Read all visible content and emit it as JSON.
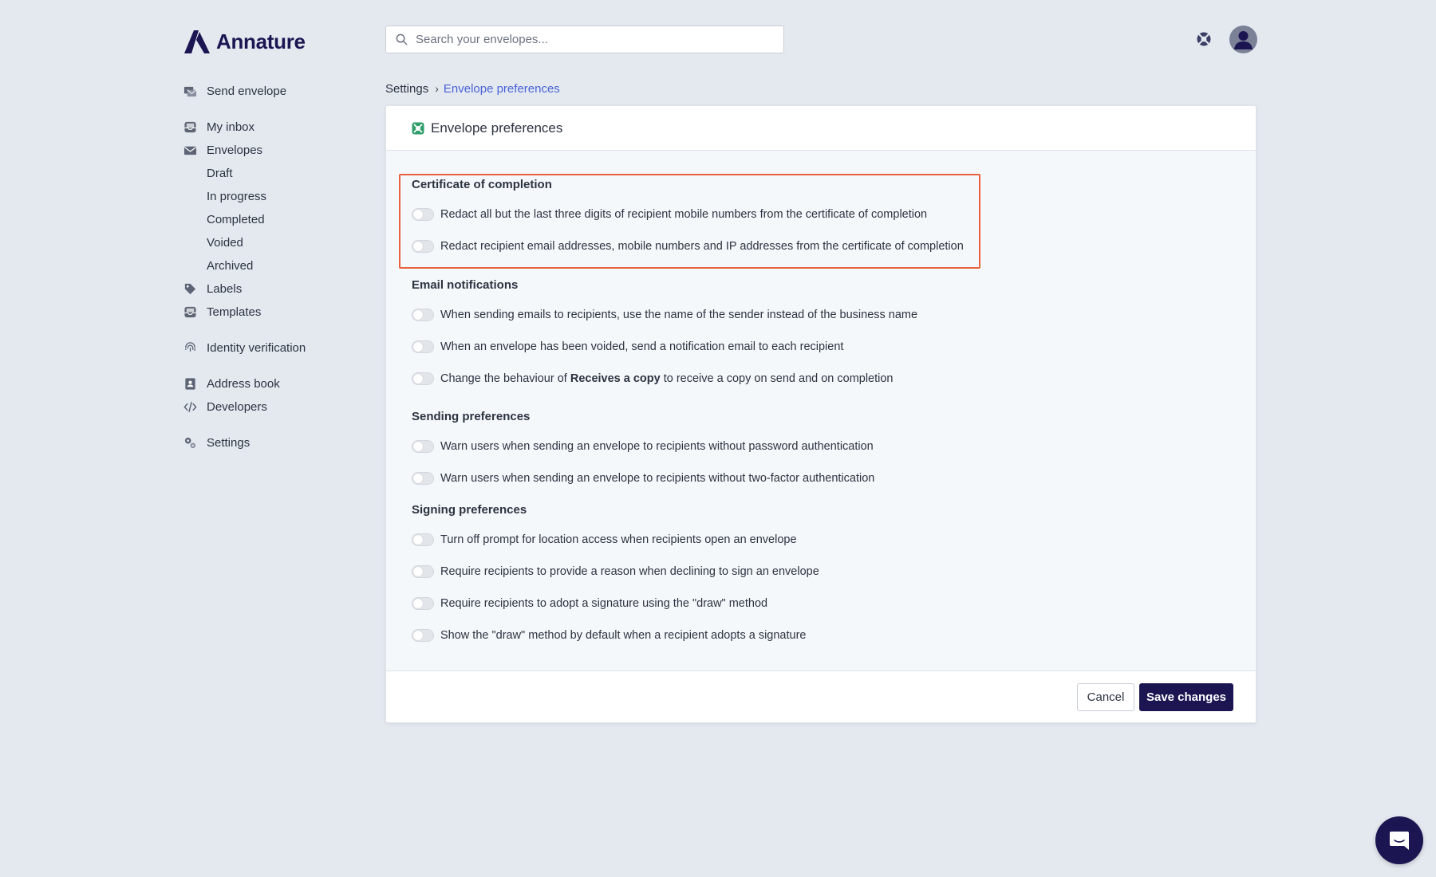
{
  "brand": {
    "name": "Annature",
    "color": "#1b1652"
  },
  "search": {
    "placeholder": "Search your envelopes..."
  },
  "sidebar": {
    "send_envelope": "Send envelope",
    "my_inbox": "My inbox",
    "envelopes": "Envelopes",
    "draft": "Draft",
    "in_progress": "In progress",
    "completed": "Completed",
    "voided": "Voided",
    "archived": "Archived",
    "labels": "Labels",
    "templates": "Templates",
    "identity_verification": "Identity verification",
    "address_book": "Address book",
    "developers": "Developers",
    "settings": "Settings"
  },
  "breadcrumb": {
    "root": "Settings",
    "current": "Envelope preferences"
  },
  "card": {
    "title": "Envelope preferences",
    "sections": {
      "certificate": {
        "title": "Certificate of completion",
        "items": [
          "Redact all but the last three digits of recipient mobile numbers from the certificate of completion",
          "Redact recipient email addresses, mobile numbers and IP addresses from the certificate of completion"
        ]
      },
      "email": {
        "title": "Email notifications",
        "items": [
          "When sending emails to recipients, use the name of the sender instead of the business name",
          "When an envelope has been voided, send a notification email to each recipient"
        ],
        "copy_item": {
          "prefix": "Change the behaviour of ",
          "bold": "Receives a copy",
          "suffix": " to receive a copy on send and on completion"
        }
      },
      "sending": {
        "title": "Sending preferences",
        "items": [
          "Warn users when sending an envelope to recipients without password authentication",
          "Warn users when sending an envelope to recipients without two-factor authentication"
        ]
      },
      "signing": {
        "title": "Signing preferences",
        "items": [
          "Turn off prompt for location access when recipients open an envelope",
          "Require recipients to provide a reason when declining to sign an envelope",
          "Require recipients to adopt a signature using the \"draw\" method",
          "Show the \"draw\" method by default when a recipient adopts a signature"
        ]
      }
    },
    "footer": {
      "cancel": "Cancel",
      "save": "Save changes"
    }
  },
  "colors": {
    "accent": "#4a63d6",
    "highlight": "#e8613c",
    "primary": "#1b1652"
  }
}
